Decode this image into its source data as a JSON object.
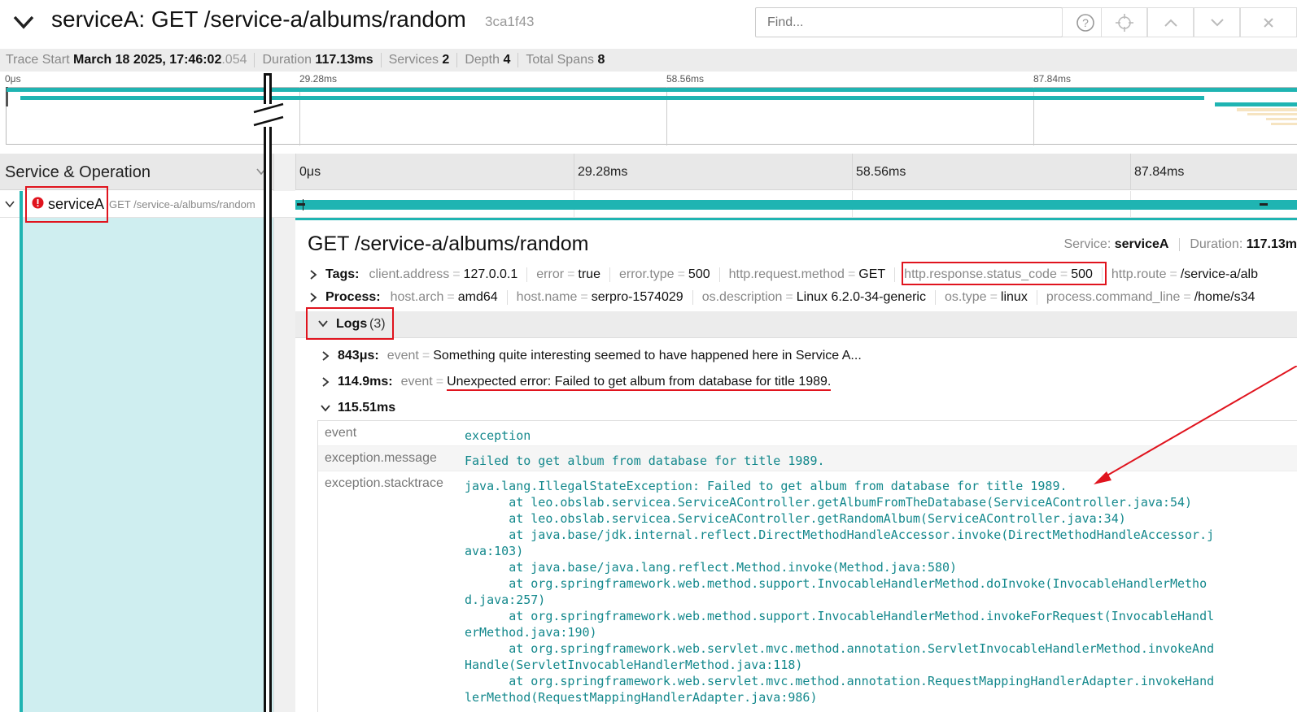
{
  "header": {
    "title": "serviceA: GET /service-a/albums/random",
    "trace_id": "3ca1f43",
    "find_placeholder": "Find..."
  },
  "summary": {
    "trace_start_label": "Trace Start",
    "trace_start_value": "March 18 2025, 17:46:02",
    "trace_start_ms": ".054",
    "duration_label": "Duration",
    "duration_value": "117.13ms",
    "services_label": "Services",
    "services_value": "2",
    "depth_label": "Depth",
    "depth_value": "4",
    "total_spans_label": "Total Spans",
    "total_spans_value": "8"
  },
  "minimap": {
    "ticks": [
      "0μs",
      "29.28ms",
      "58.56ms",
      "87.84ms"
    ]
  },
  "columns": {
    "service_operation": "Service & Operation",
    "ticks": [
      "0μs",
      "29.28ms",
      "58.56ms",
      "87.84ms"
    ]
  },
  "span": {
    "service": "serviceA",
    "operation": "GET /service-a/albums/random"
  },
  "detail": {
    "title": "GET /service-a/albums/random",
    "service_label": "Service:",
    "service_value": "serviceA",
    "duration_label": "Duration:",
    "duration_value": "117.13m",
    "tags_label": "Tags:",
    "tags": [
      {
        "k": "client.address",
        "v": "127.0.0.1"
      },
      {
        "k": "error",
        "v": "true"
      },
      {
        "k": "error.type",
        "v": "500"
      },
      {
        "k": "http.request.method",
        "v": "GET"
      },
      {
        "k": "http.response.status_code",
        "v": "500"
      },
      {
        "k": "http.route",
        "v": "/service-a/alb"
      }
    ],
    "process_label": "Process:",
    "process": [
      {
        "k": "host.arch",
        "v": "amd64"
      },
      {
        "k": "host.name",
        "v": "serpro-1574029"
      },
      {
        "k": "os.description",
        "v": "Linux 6.2.0-34-generic"
      },
      {
        "k": "os.type",
        "v": "linux"
      },
      {
        "k": "process.command_line",
        "v": "/home/s34"
      }
    ],
    "logs_label": "Logs",
    "logs_count": "(3)",
    "logs": [
      {
        "ts": "843μs:",
        "k": "event",
        "v": "Something quite interesting seemed to have happened here in Service A..."
      },
      {
        "ts": "114.9ms:",
        "k": "event",
        "v": "Unexpected error: Failed to get album from database for title 1989."
      },
      {
        "ts": "115.51ms"
      }
    ],
    "log_fields": [
      {
        "k": "event",
        "v": "exception"
      },
      {
        "k": "exception.message",
        "v": "Failed to get album from database for title 1989."
      },
      {
        "k": "exception.stacktrace",
        "v": "java.lang.IllegalStateException: Failed to get album from database for title 1989.\n\tat leo.obslab.servicea.ServiceAController.getAlbumFromTheDatabase(ServiceAController.java:54)\n\tat leo.obslab.servicea.ServiceAController.getRandomAlbum(ServiceAController.java:34)\n\tat java.base/jdk.internal.reflect.DirectMethodHandleAccessor.invoke(DirectMethodHandleAccessor.j\nava:103)\n\tat java.base/java.lang.reflect.Method.invoke(Method.java:580)\n\tat org.springframework.web.method.support.InvocableHandlerMethod.doInvoke(InvocableHandlerMetho\nd.java:257)\n\tat org.springframework.web.method.support.InvocableHandlerMethod.invokeForRequest(InvocableHandl\nerMethod.java:190)\n\tat org.springframework.web.servlet.mvc.method.annotation.ServletInvocableHandlerMethod.invokeAnd\nHandle(ServletInvocableHandlerMethod.java:118)\n\tat org.springframework.web.servlet.mvc.method.annotation.RequestMappingHandlerAdapter.invokeHand\nlerMethod(RequestMappingHandlerAdapter.java:986)"
      }
    ]
  },
  "colors": {
    "teal": "#1fb4b2",
    "teal_light": "#cfeef0",
    "error_red": "#e0141e",
    "annotation_red": "#e0141e",
    "mono_text": "#13888c"
  }
}
